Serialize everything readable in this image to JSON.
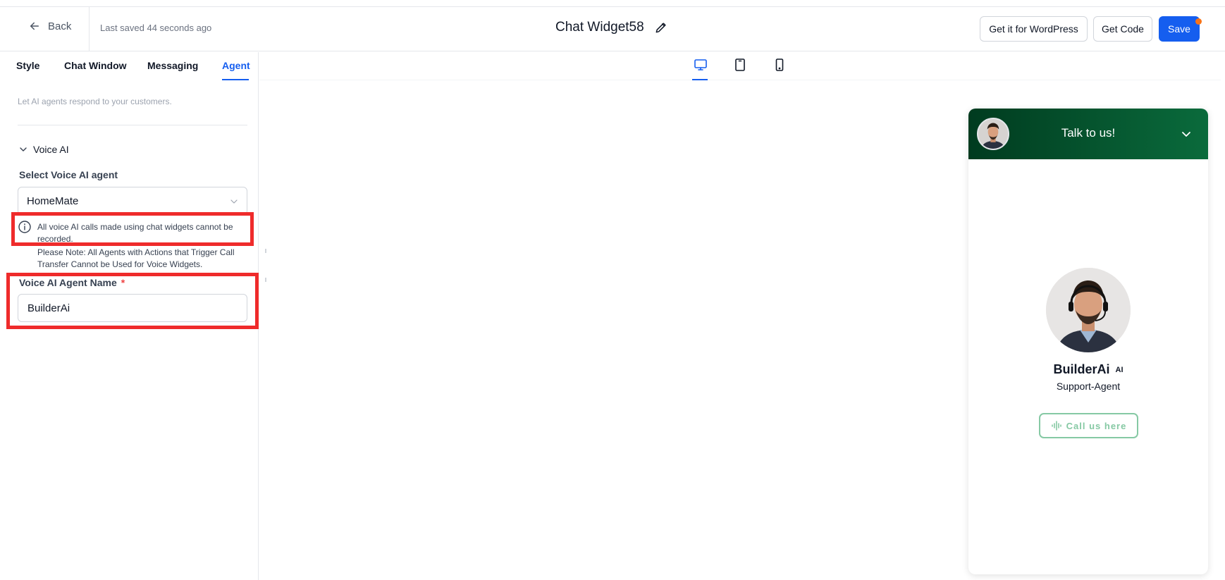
{
  "header": {
    "back_label": "Back",
    "last_saved": "Last saved 44 seconds ago",
    "title": "Chat Widget58",
    "wordpress_label": "Get it for WordPress",
    "get_code_label": "Get Code",
    "save_label": "Save"
  },
  "tabs": [
    {
      "label": "Style",
      "active": false
    },
    {
      "label": "Chat Window",
      "active": false
    },
    {
      "label": "Messaging",
      "active": false
    },
    {
      "label": "Agent",
      "active": true
    }
  ],
  "agent_panel": {
    "description": "Let AI agents respond to your customers.",
    "voice_section_label": "Voice AI",
    "select_label": "Select Voice AI agent",
    "selected_agent": "HomeMate",
    "info_text": "All voice AI calls made using chat widgets cannot be recorded.",
    "note_text": "Please Note: All Agents with Actions that Trigger Call Transfer Cannot be Used for Voice Widgets.",
    "name_label": "Voice AI Agent Name",
    "required_mark": "*",
    "name_value": "BuilderAi"
  },
  "devices": [
    {
      "name": "desktop-icon",
      "active": true
    },
    {
      "name": "tablet-icon",
      "active": false
    },
    {
      "name": "mobile-icon",
      "active": false
    }
  ],
  "widget": {
    "header_title": "Talk to us!",
    "agent_name": "BuilderAi",
    "ai_badge": "AI",
    "role": "Support-Agent",
    "call_label": "Call us here"
  },
  "colors": {
    "accent": "#155eef",
    "highlight": "#ef2b2b",
    "widget_header_start": "#003b1f",
    "widget_header_end": "#0a6b3c",
    "call_button": "#86c9a4",
    "notification_dot": "#f97316"
  }
}
